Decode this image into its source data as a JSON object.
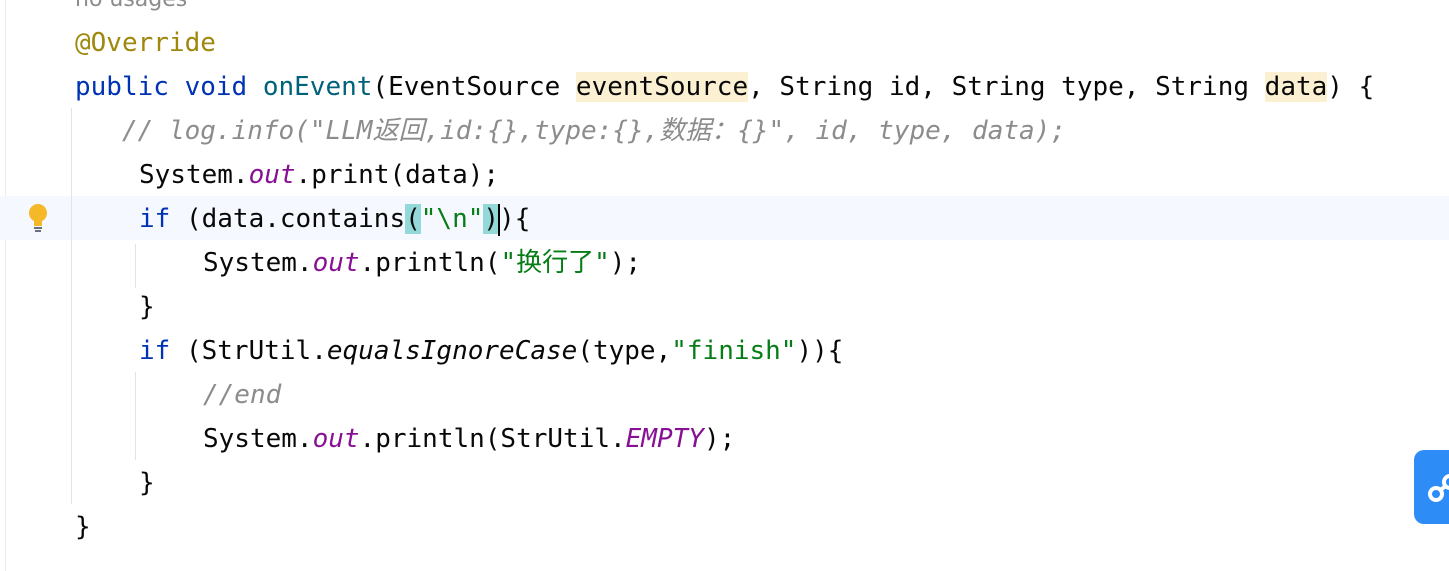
{
  "editor": {
    "inlay_hint": "no usages",
    "annotation": "@Override",
    "signature": {
      "modifiers": "public void ",
      "method_name": "onEvent",
      "open_paren": "(",
      "p1_type": "EventSource ",
      "p1_name": "eventSource",
      "sep1": ", String id, String type, String ",
      "p4_name": "data",
      "tail": ") {"
    },
    "line_comment": "// log.info(\"LLM返回,id:{},type:{},数据：{}\", id, type, data);",
    "line_print": {
      "obj": "System.",
      "field": "out",
      "call": ".print(data);"
    },
    "line_if1": {
      "kw": "if",
      "pre": " (data.contains",
      "lparen": "(",
      "str": "\"\\n\"",
      "rparen": ")",
      "after_caret": "){"
    },
    "line_println1": {
      "obj": "System.",
      "field": "out",
      "call": ".println(",
      "str": "\"换行了\"",
      "end": ");"
    },
    "close_brace1": "}",
    "line_if2": {
      "kw": "if",
      "pre": " (StrUtil.",
      "method": "equalsIgnoreCase",
      "args": "(type,",
      "str": "\"finish\"",
      "end": ")){"
    },
    "line_end_comment": "//end",
    "line_println2": {
      "obj": "System.",
      "field": "out",
      "call": ".println(StrUtil.",
      "const": "EMPTY",
      "end": ");"
    },
    "close_brace2": "}",
    "close_brace3": "}"
  },
  "icons": {
    "gutter": "lightbulb-icon",
    "floating": "ai-assistant-icon"
  },
  "colors": {
    "keyword": "#0033b3",
    "method_declaration": "#00627a",
    "string": "#067d17",
    "comment": "#8c8c8c",
    "annotation": "#9e880d",
    "static_field": "#871094",
    "param_highlight": "#fcf0d3",
    "brace_match": "#93d9d9",
    "current_line": "#f5f8fe",
    "assistant_button": "#2d8cf5"
  }
}
